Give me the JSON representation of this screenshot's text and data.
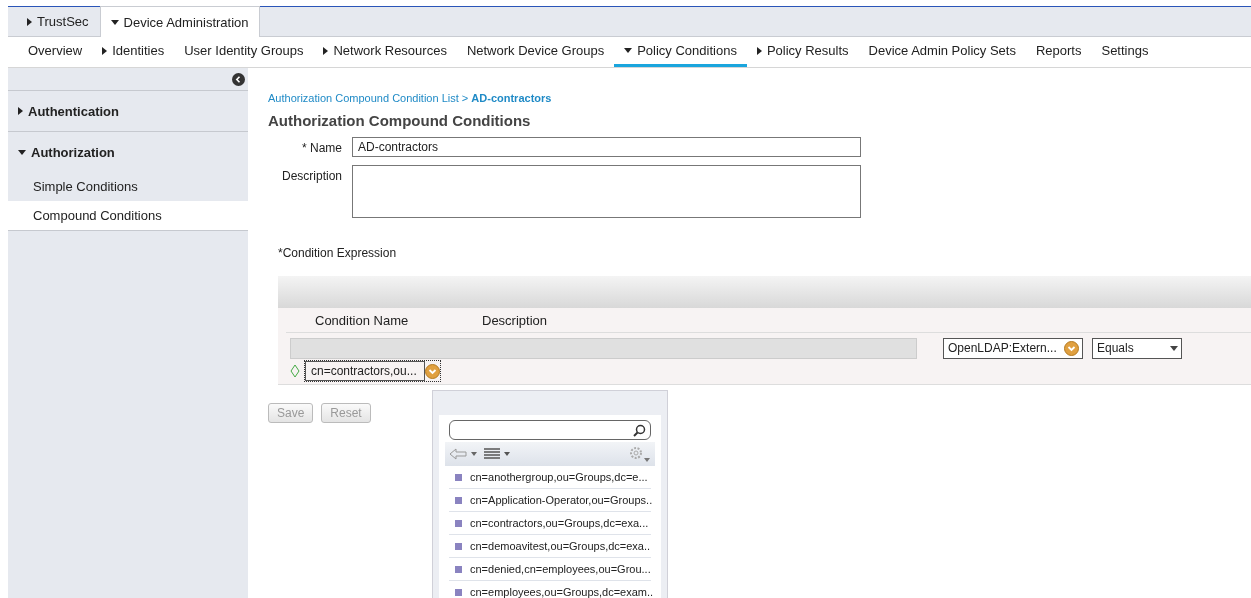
{
  "top_tabs": [
    {
      "label": "TrustSec",
      "expanded": false,
      "selected": false
    },
    {
      "label": "Device Administration",
      "expanded": true,
      "selected": true
    }
  ],
  "nav": [
    {
      "label": "Overview",
      "menu": false,
      "selected": false
    },
    {
      "label": "Identities",
      "menu": true,
      "expanded": false,
      "selected": false
    },
    {
      "label": "User Identity Groups",
      "menu": false,
      "selected": false
    },
    {
      "label": "Network Resources",
      "menu": true,
      "expanded": false,
      "selected": false
    },
    {
      "label": "Network Device Groups",
      "menu": false,
      "selected": false
    },
    {
      "label": "Policy Conditions",
      "menu": true,
      "expanded": true,
      "selected": true
    },
    {
      "label": "Policy Results",
      "menu": true,
      "expanded": false,
      "selected": false
    },
    {
      "label": "Device Admin Policy Sets",
      "menu": false,
      "selected": false
    },
    {
      "label": "Reports",
      "menu": false,
      "selected": false
    },
    {
      "label": "Settings",
      "menu": false,
      "selected": false
    }
  ],
  "sidebar": {
    "sections": [
      {
        "label": "Authentication",
        "expanded": false
      },
      {
        "label": "Authorization",
        "expanded": true,
        "children": [
          {
            "label": "Simple Conditions",
            "selected": false
          },
          {
            "label": "Compound Conditions",
            "selected": true
          }
        ]
      }
    ]
  },
  "breadcrumb": {
    "link": "Authorization Compound Condition List",
    "separator": ">",
    "current": "AD-contractors"
  },
  "title": "Authorization Compound Conditions",
  "form": {
    "name_label": "* Name",
    "name_value": "AD-contractors",
    "description_label": "Description"
  },
  "condition_expression": {
    "label": "*Condition Expression",
    "columns": [
      "Condition Name",
      "Description"
    ],
    "attribute": "OpenLDAP:Extern...",
    "operator": "Equals",
    "value": "cn=contractors,ou..."
  },
  "buttons": [
    {
      "label": "Save",
      "disabled": true
    },
    {
      "label": "Reset",
      "disabled": true
    }
  ],
  "popup": {
    "items": [
      "cn=anothergroup,ou=Groups,dc=e...",
      "cn=Application-Operator,ou=Groups..",
      "cn=contractors,ou=Groups,dc=exa...",
      "cn=demoavitest,ou=Groups,dc=exa..",
      "cn=denied,cn=employees,ou=Grou...",
      "cn=employees,ou=Groups,dc=exam.."
    ]
  }
}
